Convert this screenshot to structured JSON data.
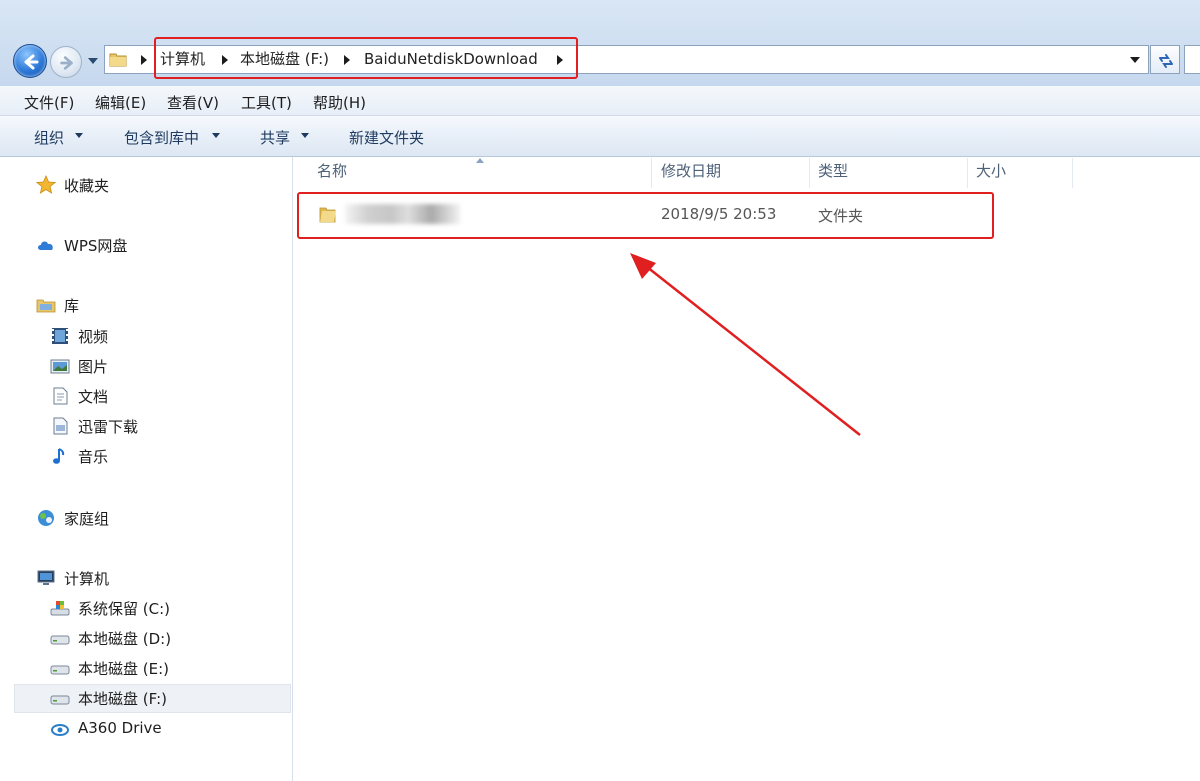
{
  "breadcrumb": {
    "items": [
      "计算机",
      "本地磁盘 (F:)",
      "BaiduNetdiskDownload"
    ]
  },
  "menubar": {
    "items": [
      "文件(F)",
      "编辑(E)",
      "查看(V)",
      "工具(T)",
      "帮助(H)"
    ]
  },
  "toolbar": {
    "organize": "组织",
    "include_library": "包含到库中",
    "share": "共享",
    "new_folder": "新建文件夹"
  },
  "sidebar": {
    "favorites": "收藏夹",
    "wps": "WPS网盘",
    "libraries": "库",
    "library_items": [
      "视频",
      "图片",
      "文档",
      "迅雷下载",
      "音乐"
    ],
    "homegroup": "家庭组",
    "computer": "计算机",
    "drives": [
      "系统保留 (C:)",
      "本地磁盘 (D:)",
      "本地磁盘 (E:)",
      "本地磁盘 (F:)"
    ],
    "a360": "A360 Drive",
    "selected_item": "本地磁盘 (F:)"
  },
  "columns": [
    "名称",
    "修改日期",
    "类型",
    "大小"
  ],
  "files": [
    {
      "name_blurred": true,
      "modified": "2018/9/5 20:53",
      "type": "文件夹",
      "size": ""
    }
  ],
  "annotation_color": "#e02020"
}
